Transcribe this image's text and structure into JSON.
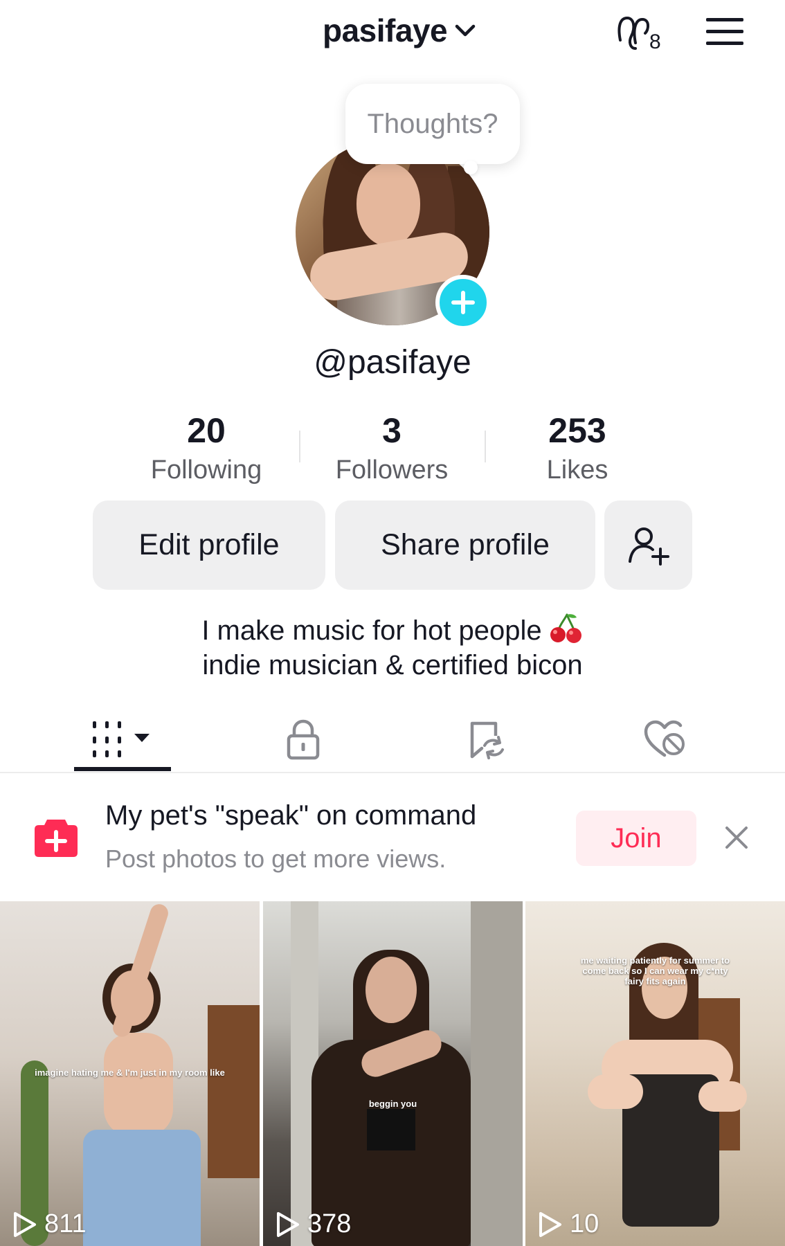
{
  "header": {
    "username": "pasifaye",
    "creator_badge": "8",
    "icons": {
      "switch": "chevron-down-icon",
      "creator_tools": "creator-tools-icon",
      "menu": "hamburger-menu-icon"
    }
  },
  "avatar": {
    "thoughts_placeholder": "Thoughts?",
    "add_icon": "plus-icon"
  },
  "profile": {
    "handle": "@pasifaye"
  },
  "stats": [
    {
      "value": "20",
      "label": "Following"
    },
    {
      "value": "3",
      "label": "Followers"
    },
    {
      "value": "253",
      "label": "Likes"
    }
  ],
  "actions": {
    "edit_profile": "Edit profile",
    "share_profile": "Share profile",
    "add_friends_icon": "add-user-icon"
  },
  "bio": {
    "line1": "I make music for hot people",
    "line1_emoji": "cherry-emoji",
    "line2": "indie musician & certified bicon"
  },
  "tabs": [
    {
      "name": "videos",
      "icon": "grid-icon",
      "active": true
    },
    {
      "name": "private",
      "icon": "lock-icon"
    },
    {
      "name": "reposts",
      "icon": "repost-icon"
    },
    {
      "name": "liked",
      "icon": "liked-heart-icon"
    }
  ],
  "promo": {
    "title": "My pet's \"speak\" on command",
    "subtitle": "Post photos to get more views.",
    "join_label": "Join",
    "icon": "add-post-icon",
    "close_icon": "close-icon"
  },
  "videos": [
    {
      "views": "811",
      "caption": "imagine hating me & I'm just in my room like"
    },
    {
      "views": "378",
      "caption": "beggin you"
    },
    {
      "views": "10",
      "caption": "me waiting patiently for summer to come back so I can wear my c*nty fairy fits again"
    }
  ],
  "colors": {
    "accent_cyan": "#20d5ec",
    "brand_red": "#fe2c55",
    "button_gray": "#efeff0",
    "text_primary": "#161823",
    "text_secondary": "#8a8b91"
  }
}
